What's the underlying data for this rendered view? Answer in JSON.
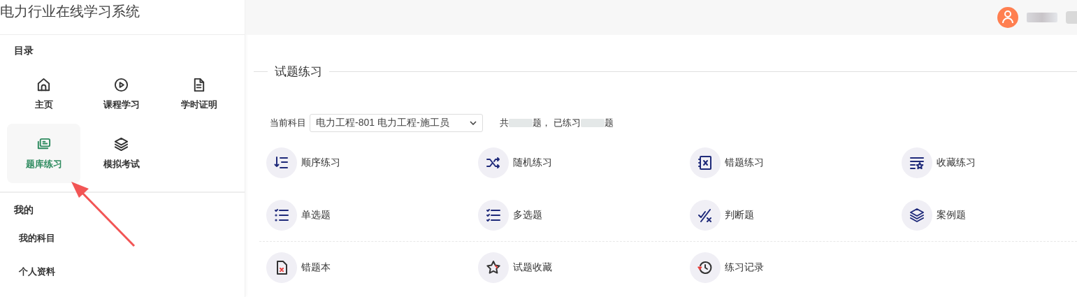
{
  "sidebar": {
    "title": "电力行业在线学习系统",
    "catalog": {
      "heading": "目录",
      "items": [
        {
          "label": "主页",
          "selected": false
        },
        {
          "label": "课程学习",
          "selected": false
        },
        {
          "label": "学时证明",
          "selected": false
        },
        {
          "label": "题库练习",
          "selected": true
        },
        {
          "label": "模拟考试",
          "selected": false
        }
      ]
    },
    "mine": {
      "heading": "我的",
      "items": [
        "我的科目",
        "个人资料"
      ]
    }
  },
  "practice": {
    "title": "试题练习",
    "subject_label": "当前科目",
    "subject": "电力工程-801 电力工程-施工员",
    "stats": [
      "共",
      "题， 已练习",
      "题"
    ],
    "groups": [
      [
        {
          "label": "顺序练习"
        },
        {
          "label": "随机练习"
        },
        {
          "label": "错题练习"
        },
        {
          "label": "收藏练习"
        },
        {
          "label": "单选题"
        },
        {
          "label": "多选题"
        },
        {
          "label": "判断题"
        },
        {
          "label": "案例题"
        }
      ],
      [
        {
          "label": "错题本"
        },
        {
          "label": "试题收藏"
        },
        {
          "label": "练习记录"
        }
      ]
    ]
  }
}
